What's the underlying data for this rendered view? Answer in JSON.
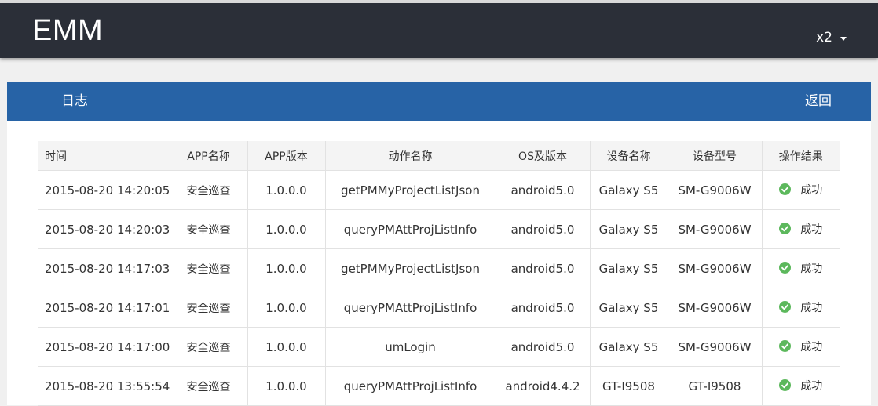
{
  "header": {
    "brand": "EMM",
    "user": "x2"
  },
  "panel": {
    "title": "日志",
    "back_label": "返回"
  },
  "table": {
    "columns": [
      "时间",
      "APP名称",
      "APP版本",
      "动作名称",
      "OS及版本",
      "设备名称",
      "设备型号",
      "操作结果"
    ],
    "rows": [
      {
        "time": "2015-08-20 14:20:05",
        "app_name": "安全巡查",
        "app_version": "1.0.0.0",
        "action": "getPMMyProjectListJson",
        "os": "android5.0",
        "device_name": "Galaxy S5",
        "device_model": "SM-G9006W",
        "result": "成功"
      },
      {
        "time": "2015-08-20 14:20:03",
        "app_name": "安全巡查",
        "app_version": "1.0.0.0",
        "action": "queryPMAttProjListInfo",
        "os": "android5.0",
        "device_name": "Galaxy S5",
        "device_model": "SM-G9006W",
        "result": "成功"
      },
      {
        "time": "2015-08-20 14:17:03",
        "app_name": "安全巡查",
        "app_version": "1.0.0.0",
        "action": "getPMMyProjectListJson",
        "os": "android5.0",
        "device_name": "Galaxy S5",
        "device_model": "SM-G9006W",
        "result": "成功"
      },
      {
        "time": "2015-08-20 14:17:01",
        "app_name": "安全巡查",
        "app_version": "1.0.0.0",
        "action": "queryPMAttProjListInfo",
        "os": "android5.0",
        "device_name": "Galaxy S5",
        "device_model": "SM-G9006W",
        "result": "成功"
      },
      {
        "time": "2015-08-20 14:17:00",
        "app_name": "安全巡查",
        "app_version": "1.0.0.0",
        "action": "umLogin",
        "os": "android5.0",
        "device_name": "Galaxy S5",
        "device_model": "SM-G9006W",
        "result": "成功"
      },
      {
        "time": "2015-08-20 13:55:54",
        "app_name": "安全巡查",
        "app_version": "1.0.0.0",
        "action": "queryPMAttProjListInfo",
        "os": "android4.4.2",
        "device_name": "GT-I9508",
        "device_model": "GT-I9508",
        "result": "成功"
      }
    ]
  },
  "icons": {
    "result_icon": "check-circle-icon",
    "user_menu_icon": "caret-down-icon"
  },
  "colors": {
    "topbar": "#2b2f38",
    "panel_header": "#2763a6",
    "success": "#5cb85c"
  }
}
